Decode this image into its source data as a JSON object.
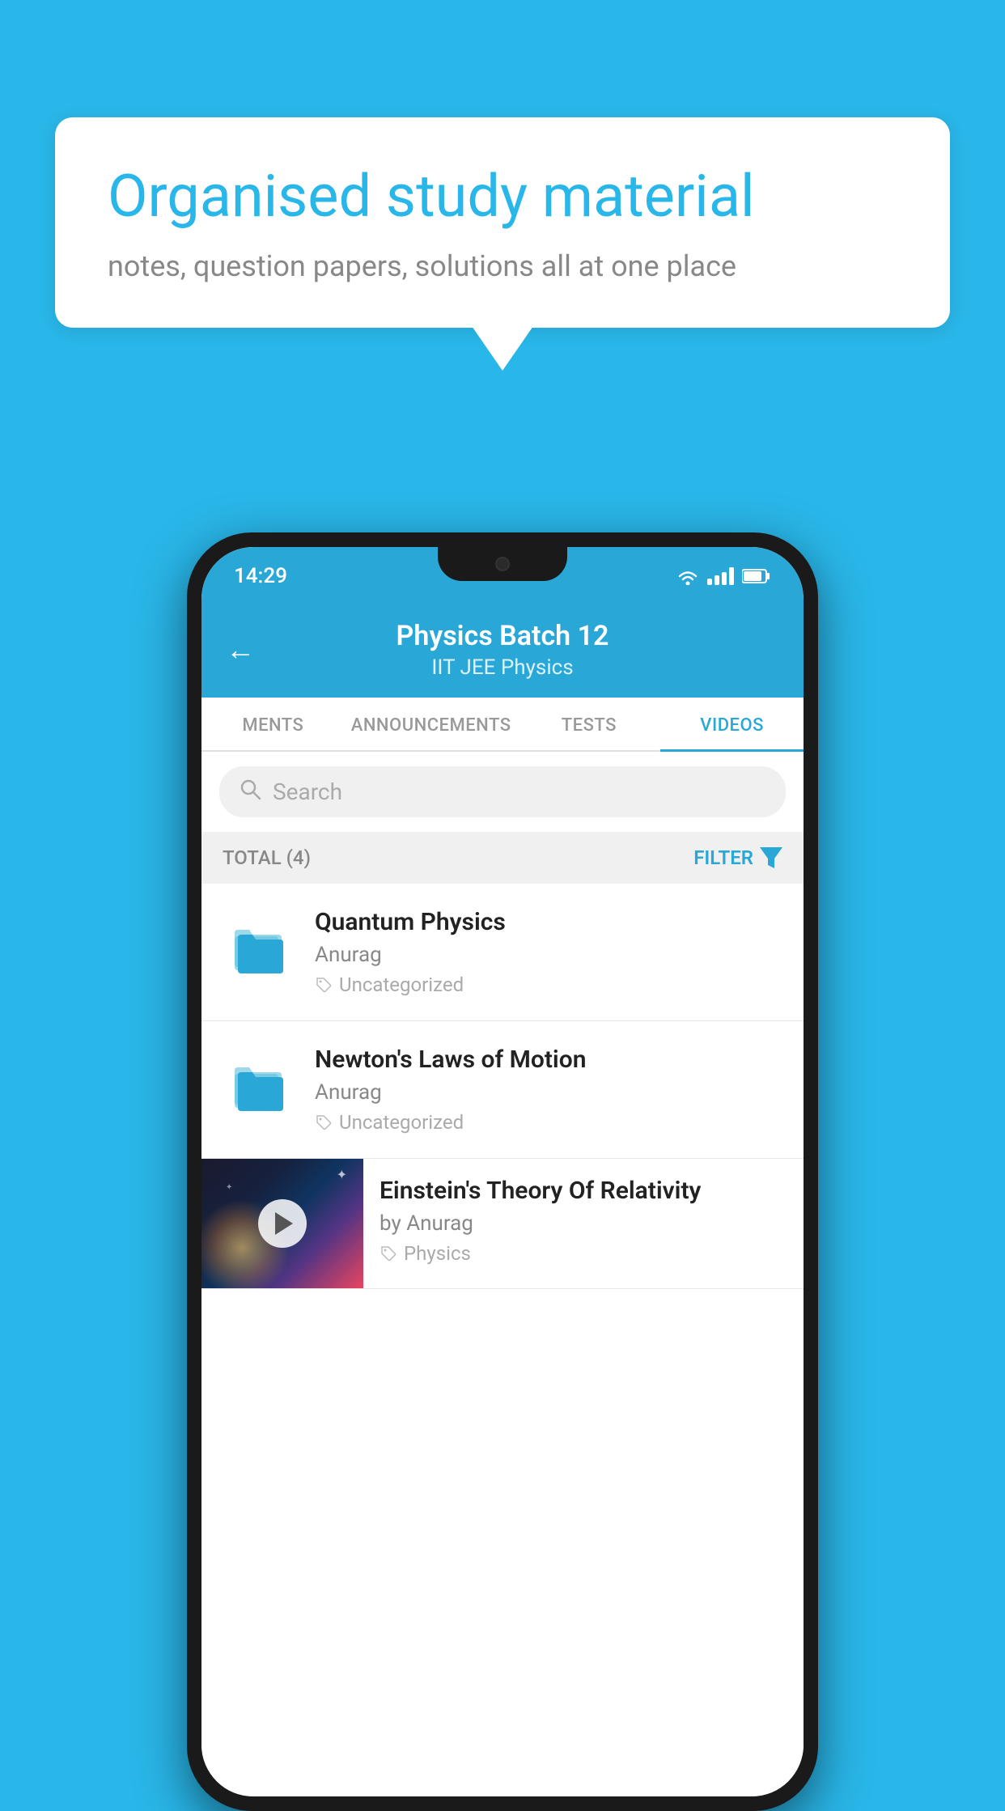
{
  "background": {
    "color": "#29B6E8"
  },
  "speech_bubble": {
    "title": "Organised study material",
    "subtitle": "notes, question papers, solutions all at one place"
  },
  "phone": {
    "status_bar": {
      "time": "14:29",
      "wifi": "▲",
      "signal": [
        3,
        5,
        7,
        9
      ],
      "battery": "▮"
    },
    "header": {
      "back_label": "←",
      "title": "Physics Batch 12",
      "subtitle": "IIT JEE   Physics"
    },
    "tabs": [
      {
        "label": "MENTS",
        "active": false
      },
      {
        "label": "ANNOUNCEMENTS",
        "active": false
      },
      {
        "label": "TESTS",
        "active": false
      },
      {
        "label": "VIDEOS",
        "active": true
      }
    ],
    "search": {
      "placeholder": "Search"
    },
    "filter_bar": {
      "total_label": "TOTAL (4)",
      "filter_label": "FILTER"
    },
    "items": [
      {
        "type": "folder",
        "title": "Quantum Physics",
        "author": "Anurag",
        "tag": "Uncategorized"
      },
      {
        "type": "folder",
        "title": "Newton's Laws of Motion",
        "author": "Anurag",
        "tag": "Uncategorized"
      },
      {
        "type": "video",
        "title": "Einstein's Theory Of Relativity",
        "author": "by Anurag",
        "tag": "Physics"
      }
    ]
  }
}
